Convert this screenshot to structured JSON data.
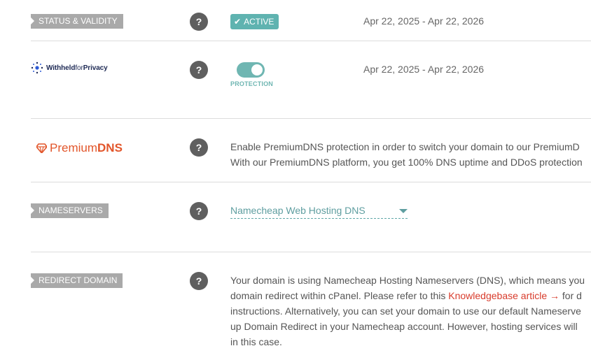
{
  "status": {
    "label": "STATUS & VALIDITY",
    "badge": "ACTIVE",
    "dates": "Apr 22, 2025 - Apr 22, 2026"
  },
  "privacy": {
    "logo_bold": "Withheld",
    "logo_light": "for",
    "logo_bold2": "Privacy",
    "toggle_label": "PROTECTION",
    "toggle_state": "on",
    "dates": "Apr 22, 2025 - Apr 22, 2026"
  },
  "premiumdns": {
    "logo_light": "Premium",
    "logo_bold": "DNS",
    "line1": "Enable PremiumDNS protection in order to switch your domain to our PremiumD",
    "line2": "With our PremiumDNS platform, you get 100% DNS uptime and DDoS protection"
  },
  "nameservers": {
    "label": "NAMESERVERS",
    "selected": "Namecheap Web Hosting DNS"
  },
  "redirect": {
    "label": "REDIRECT DOMAIN",
    "line1": "Your domain is using Namecheap Hosting Nameservers (DNS), which means you",
    "line2_before": "domain redirect within cPanel. Please refer to this ",
    "line2_link": "Knowledgebase article →",
    "line2_after": " for d",
    "line3": "instructions. Alternatively, you can set your domain to use our default Nameserve",
    "line4": "up Domain Redirect in your Namecheap account. However, hosting services will",
    "line5": "in this case."
  },
  "help_glyph": "?",
  "colors": {
    "accent_teal": "#5fb3b0",
    "tag_gray": "#a9a9a9",
    "premiumdns_orange": "#e2562b",
    "link_red": "#d83b2b"
  }
}
